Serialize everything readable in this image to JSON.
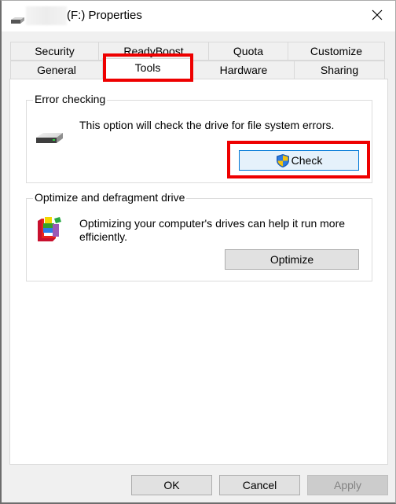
{
  "window": {
    "title": "(F:) Properties",
    "title_icon": "drive-icon",
    "close_icon": "close-icon"
  },
  "tabs": {
    "row1": [
      {
        "label": "Security"
      },
      {
        "label": "ReadyBoost"
      },
      {
        "label": "Quota"
      },
      {
        "label": "Customize"
      }
    ],
    "row2": [
      {
        "label": "General"
      },
      {
        "label": "Tools",
        "selected": true
      },
      {
        "label": "Hardware"
      },
      {
        "label": "Sharing"
      }
    ]
  },
  "error_checking": {
    "title": "Error checking",
    "icon": "drive-icon",
    "description": "This option will check the drive for file system errors.",
    "button_icon": "uac-shield-icon",
    "button_label": "Check"
  },
  "optimize": {
    "title": "Optimize and defragment drive",
    "icon": "defragment-icon",
    "description": "Optimizing your computer's drives can help it run more efficiently.",
    "button_label": "Optimize"
  },
  "footer": {
    "ok_label": "OK",
    "cancel_label": "Cancel",
    "apply_label": "Apply",
    "apply_disabled": true
  },
  "colors": {
    "highlight": "#ee0000",
    "focus_border": "#0078d7",
    "focus_fill": "#e5f1fb"
  }
}
